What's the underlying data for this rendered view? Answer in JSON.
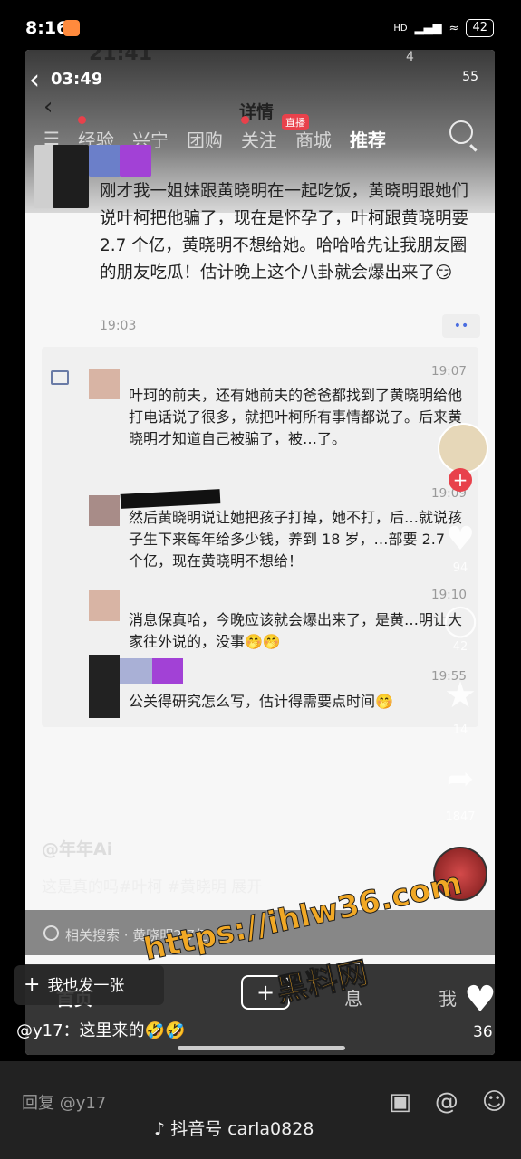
{
  "status_bar": {
    "time": "8:16",
    "app_badge": "⌕",
    "hd": "HD",
    "battery": "42"
  },
  "inner": {
    "ghost_time": "21:41",
    "ghost_badge": "4",
    "time": "03:49",
    "battery": "55",
    "detail_title": "详情",
    "nav": [
      "经验",
      "兴宁",
      "团购",
      "关注",
      "商城",
      "推荐"
    ],
    "live_badge": "直播"
  },
  "post": {
    "text": "刚才我一姐妹跟黄晓明在一起吃饭，黄晓明跟她们说叶柯把他骗了，现在是怀孕了，叶柯跟黄晓明要 2.7 个亿，黄晓明不想给她。哈哈哈先让我朋友圈的朋友吃瓜！估计晚上这个八卦就会爆出来了😏",
    "time": "19:03",
    "more": "••"
  },
  "comments": [
    {
      "time": "19:07",
      "text": "叶珂的前夫，还有她前夫的爸爸都找到了黄晓明给他打电话说了很多，就把叶柯所有事情都说了。后来黄晓明才知道自己被骗了，被…了。"
    },
    {
      "time": "19:09",
      "text": "然后黄晓明说让她把孩子打掉，她不打，后…就说孩子生下来每年给多少钱，养到 18 岁，…部要 2.7 个亿，现在黄晓明不想给！"
    },
    {
      "time": "19:10",
      "text": "消息保真哈，今晚应该就会爆出来了，是黄…明让大家往外说的，没事🤭🤭"
    },
    {
      "time": "19:55",
      "text": "公关得研究怎么写，估计得需要点时间🤭"
    }
  ],
  "right_actions": {
    "like_count": "94",
    "comment_count": "42",
    "fav_count": "14",
    "share_count": "1847"
  },
  "video": {
    "handle": "@年年Ai",
    "caption": "这是真的吗#叶柯 #黄晓明  展开",
    "related": "相关搜索 · 黄晓明2.7亿"
  },
  "bottom_nav": {
    "home": "首页",
    "me": "我",
    "msg": "息"
  },
  "watermark": {
    "line1": "https://ihlw36.com",
    "line2": "黑料网"
  },
  "overlay": {
    "add_btn": "我也发一张",
    "comment": "@y17：这里来的🤣🤣",
    "heart_count": "36"
  },
  "reply": {
    "placeholder": "回复 @y17",
    "tiktok_id": "抖音号 carla0828"
  }
}
